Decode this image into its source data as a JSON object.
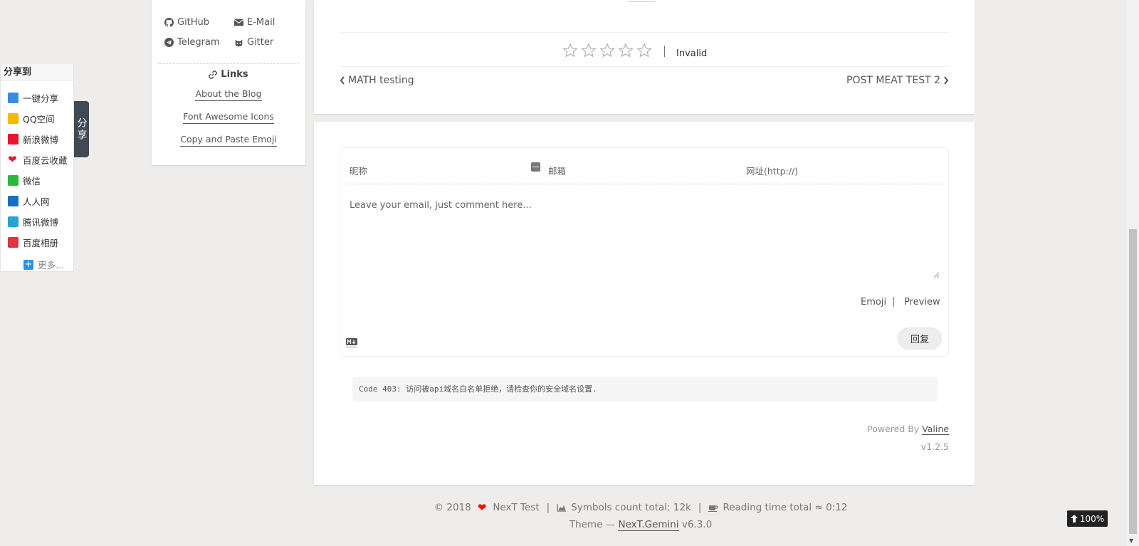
{
  "sidebar": {
    "social": [
      {
        "label": "GitHub",
        "icon": "github-icon"
      },
      {
        "label": "E-Mail",
        "icon": "envelope-icon"
      },
      {
        "label": "Telegram",
        "icon": "telegram-icon"
      },
      {
        "label": "Gitter",
        "icon": "gitter-icon"
      }
    ],
    "links_title": "Links",
    "links": [
      "About the Blog",
      "Font Awesome Icons",
      "Copy and Paste Emoji"
    ]
  },
  "share": {
    "title": "分享到",
    "items": [
      "一键分享",
      "QQ空间",
      "新浪微博",
      "百度云收藏",
      "微信",
      "人人网",
      "腾讯微博",
      "百度相册"
    ],
    "more": "更多...",
    "tab_label": "分享"
  },
  "post": {
    "rating_text": "Invalid",
    "prev_label": "MATH testing",
    "next_label": "POST MEAT TEST 2"
  },
  "comment": {
    "nick_placeholder": "昵称",
    "mail_placeholder": "邮箱",
    "url_placeholder": "网址(http://)",
    "text_placeholder": "Leave your email, just comment here...",
    "emoji_label": "Emoji",
    "preview_label": "Preview",
    "reply_label": "回复",
    "error": "Code 403: 访问被api域名白名单拒绝，请检查你的安全域名设置.",
    "powered_by": "Powered By",
    "powered_link": "Valine",
    "version": "v1.2.5"
  },
  "footer": {
    "copyright": "© 2018",
    "site": "NexT Test",
    "symbols": "Symbols count total: 12k",
    "reading": "Reading time total ≈ 0:12",
    "theme_prefix": "Theme —",
    "theme_link": "NexT.Gemini",
    "theme_version": "v6.3.0"
  },
  "back_to_top": "100%",
  "colors": {
    "heart": "#ff0000",
    "share_tab": "#3f4a55"
  }
}
